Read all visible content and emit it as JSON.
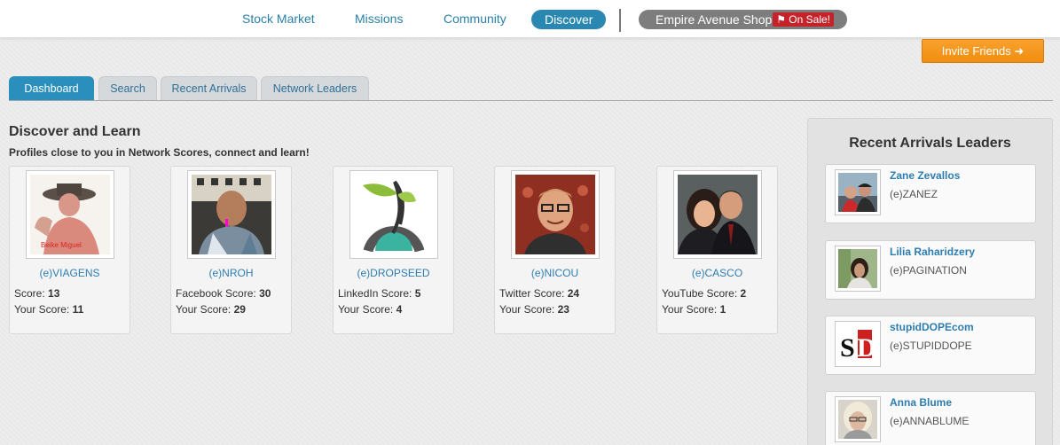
{
  "nav": {
    "items": [
      {
        "label": "Stock Market"
      },
      {
        "label": "Missions"
      },
      {
        "label": "Community"
      },
      {
        "label": "Discover"
      }
    ],
    "shop_label": "Empire Avenue Shop",
    "sale_label": "On Sale!"
  },
  "invite": {
    "label": "Invite Friends"
  },
  "tabs": [
    {
      "label": "Dashboard",
      "active": true
    },
    {
      "label": "Search"
    },
    {
      "label": "Recent Arrivals"
    },
    {
      "label": "Network Leaders"
    }
  ],
  "discover": {
    "title": "Discover and Learn",
    "subtitle": "Profiles close to you in Network Scores, connect and learn!",
    "your_score_label": "Your Score:",
    "cards": [
      {
        "handle": "(e)VIAGENS",
        "score_label": "Score:",
        "score": "13",
        "your_score": "11"
      },
      {
        "handle": "(e)NROH",
        "score_label": "Facebook Score:",
        "score": "30",
        "your_score": "29"
      },
      {
        "handle": "(e)DROPSEED",
        "score_label": "LinkedIn Score:",
        "score": "5",
        "your_score": "4"
      },
      {
        "handle": "(e)NICOU",
        "score_label": "Twitter Score:",
        "score": "24",
        "your_score": "23"
      },
      {
        "handle": "(e)CASCO",
        "score_label": "YouTube Score:",
        "score": "2",
        "your_score": "1"
      }
    ]
  },
  "panel": {
    "title": "Recent Arrivals Leaders",
    "leaders": [
      {
        "name": "Zane Zevallos",
        "handle": "(e)ZANEZ"
      },
      {
        "name": "Lilia Raharidzery",
        "handle": "(e)PAGINATION"
      },
      {
        "name": "stupidDOPEcom",
        "handle": "(e)STUPIDDOPE"
      },
      {
        "name": "Anna Blume",
        "handle": "(e)ANNABLUME"
      }
    ]
  },
  "colors": {
    "accent": "#2a87b2",
    "link": "#2e7db0",
    "invite": "#f39318",
    "sale": "#c5232a"
  }
}
